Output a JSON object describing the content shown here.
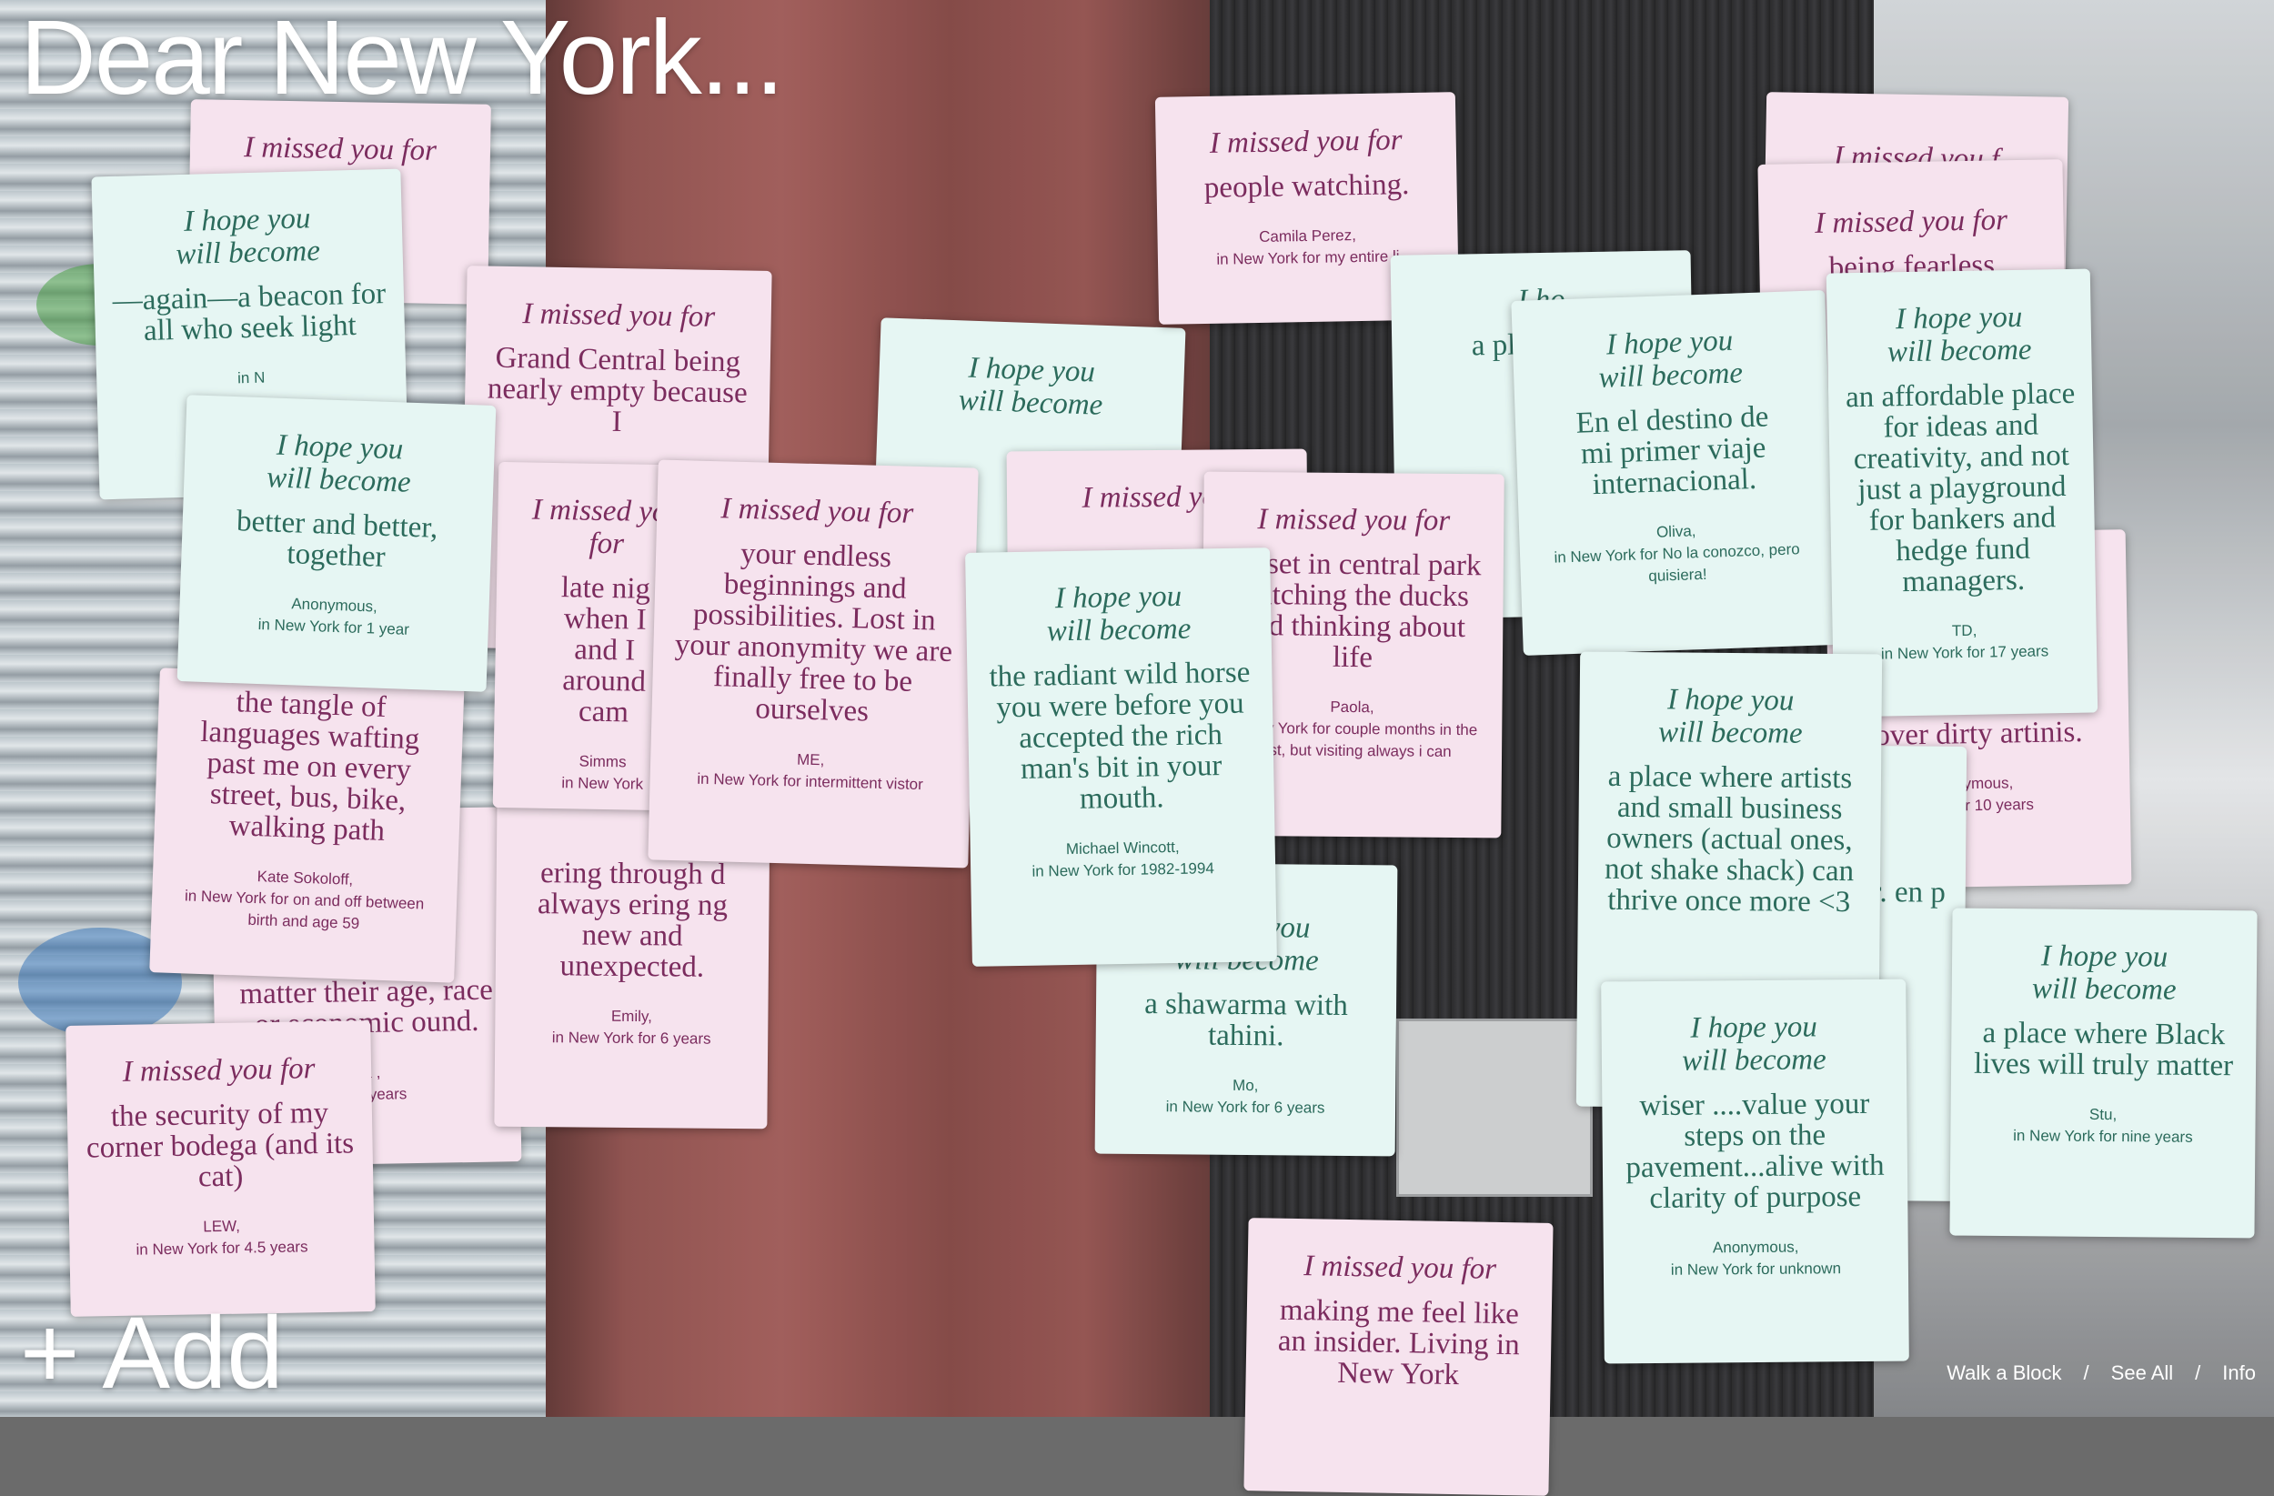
{
  "title": "Dear New York...",
  "add_label": "+ Add",
  "nav": {
    "walk": "Walk a Block",
    "sep": "/",
    "see_all": "See All",
    "info": "Info"
  },
  "colors": {
    "pink_card": "#f6e3ee",
    "pink_text": "#7b2c5e",
    "mint_card": "#e6f6f3",
    "mint_text": "#2c6b5c"
  },
  "cards": [
    {
      "type": "missed",
      "prefix": "I missed you for",
      "text": "",
      "name": "",
      "place": ""
    },
    {
      "type": "hope",
      "prefix": "I hope you will become",
      "text": "—again—a beacon for all who seek light",
      "name": "",
      "place": "in N"
    },
    {
      "type": "missed",
      "prefix": "I missed you for",
      "text": "Grand Central being nearly empty because I",
      "name": "",
      "place": ""
    },
    {
      "type": "hope",
      "prefix": "I hope you will become",
      "text": "better and better, together",
      "name": "Anonymous,",
      "place": "in New York for 1 year"
    },
    {
      "type": "missed",
      "prefix": "I missed you for",
      "text": "late nig when I and I around cam",
      "name": "Simms",
      "place": "in New York"
    },
    {
      "type": "missed",
      "prefix": "",
      "text": "the tangle of languages wafting past me on every street, bus, bike, walking path",
      "name": "Kate Sokoloff,",
      "place": "in New York for on and off between birth and age 59"
    },
    {
      "type": "missed",
      "prefix": "",
      "text": "matter their age, race or economic ound.",
      "name": "na ,",
      "place": "or 7+ years"
    },
    {
      "type": "missed",
      "prefix": "",
      "text": "ering through d always ering ng new and unexpected.",
      "name": "Emily,",
      "place": "in New York for 6 years"
    },
    {
      "type": "missed",
      "prefix": "I missed you for",
      "text": "your endless beginnings and possibilities. Lost in your anonymity we are finally free to be ourselves",
      "name": "ME,",
      "place": "in New York for intermittent vistor"
    },
    {
      "type": "missed",
      "prefix": "I missed you for",
      "text": "the security of my corner bodega (and its cat)",
      "name": "LEW,",
      "place": "in New York for 4.5 years"
    },
    {
      "type": "hope",
      "prefix": "I hope you will become",
      "text": "",
      "name": "",
      "place": ""
    },
    {
      "type": "missed",
      "prefix": "I missed you for",
      "text": "people watching.",
      "name": "Camila Perez,",
      "place": "in New York for my entire li"
    },
    {
      "type": "missed",
      "prefix": "I missed you",
      "text": "",
      "name": "",
      "place": ""
    },
    {
      "type": "hope",
      "prefix": "I hope you will become",
      "text": "the radiant wild horse you were before you accepted the rich man's bit in your mouth.",
      "name": "Michael Wincott,",
      "place": "in New York for 1982-1994"
    },
    {
      "type": "missed",
      "prefix": "I missed you for",
      "text": "sunset in central park watching the ducks and thinking about life",
      "name": "Paola,",
      "place": "in New York for couple months in the past, but visiting always i can"
    },
    {
      "type": "hope",
      "prefix": "I hope you will become",
      "text": "a shawarma with tahini.",
      "name": "Mo,",
      "place": "in New York for 6 years"
    },
    {
      "type": "hope",
      "prefix": "I ho",
      "text": "a pl outd he",
      "name": "",
      "place": ""
    },
    {
      "type": "hope",
      "prefix": "I hope you will become",
      "text": "En el destino de mi primer viaje internacional.",
      "name": "Oliva,",
      "place": "in New York for No la conozco, pero quisiera!"
    },
    {
      "type": "missed",
      "prefix": "I missed you f",
      "text": "",
      "name": "",
      "place": ""
    },
    {
      "type": "missed",
      "prefix": "I missed you for",
      "text": "being fearless",
      "name": "",
      "place": ""
    },
    {
      "type": "missed",
      "prefix": "",
      "text": "over dirty artinis.",
      "name": "onymous,",
      "place": "ork for 10 years"
    },
    {
      "type": "hope",
      "prefix": "I hope you will become",
      "text": "an affordable place for ideas and creativity, and not just a playground for bankers and hedge fund managers.",
      "name": "TD,",
      "place": "in New York for 17 years"
    },
    {
      "type": "hope",
      "prefix": "I hope you will become",
      "text": "a place where artists and small business owners (actual ones, not shake shack) can thrive once more <3",
      "name": "",
      "place": ""
    },
    {
      "type": "hope",
      "prefix": "",
      "text": "er. en p",
      "name": "",
      "place": ""
    },
    {
      "type": "hope",
      "prefix": "I hope you will become",
      "text": "a place where Black lives will truly matter",
      "name": "Stu,",
      "place": "in New York for nine years"
    },
    {
      "type": "hope",
      "prefix": "I hope you will become",
      "text": "wiser ....value your steps on the pavement...alive with clarity of purpose",
      "name": "Anonymous,",
      "place": "in New York for unknown"
    },
    {
      "type": "missed",
      "prefix": "I missed you for",
      "text": "making me feel like an insider. Living in New York",
      "name": "",
      "place": ""
    }
  ]
}
